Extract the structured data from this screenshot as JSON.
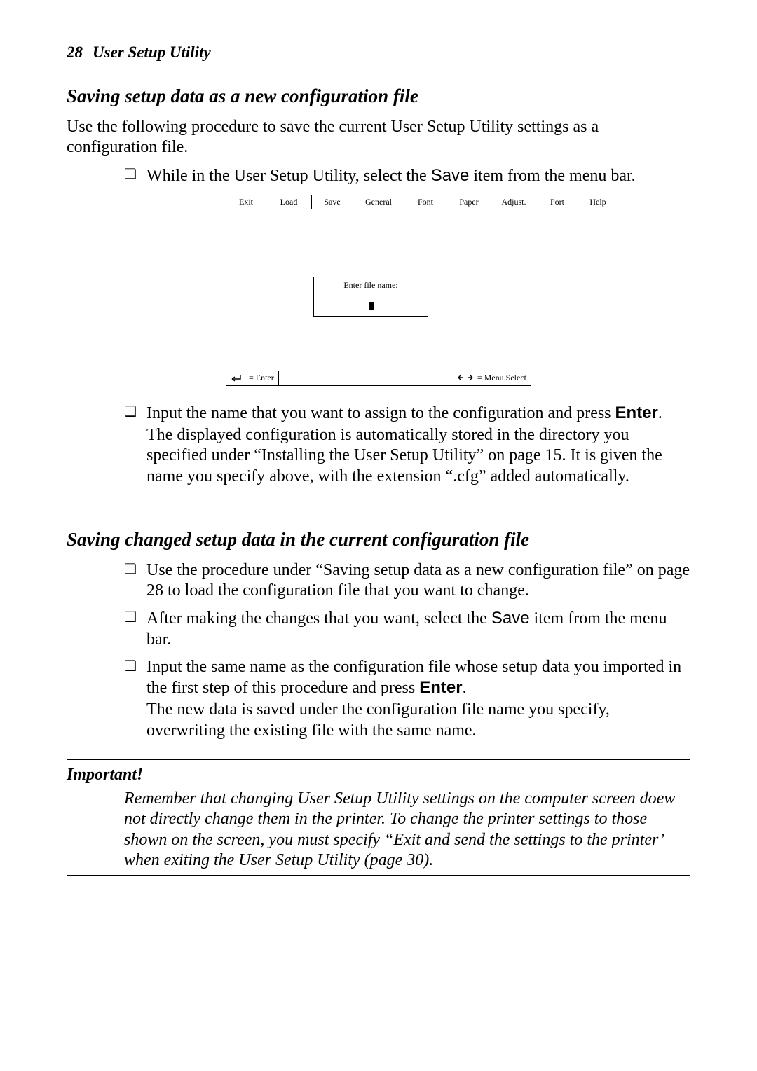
{
  "header": {
    "page_number": "28",
    "running_title": "User Setup Utility"
  },
  "section1": {
    "heading": "Saving setup data as a new configuration file",
    "intro": "Use the following procedure to save the current User Setup Utility settings as a configuration file.",
    "bullet1_pre": "While in the User Setup Utility, select the ",
    "bullet1_save": "Save",
    "bullet1_post": " item from the menu bar.",
    "bullet2_pre": "Input the name that you want to assign to the configuration and press ",
    "bullet2_enter": "Enter",
    "bullet2_post": ".",
    "bullet2_follow": "The displayed configuration is automatically stored in the directory you specified under “Installing the User Setup Utility” on page 15. It is given the name you specify above, with the extension “.cfg” added automatically."
  },
  "figure": {
    "menu": {
      "exit": "Exit",
      "load": "Load",
      "save": "Save",
      "general": "General",
      "font": "Font",
      "paper": "Paper",
      "adjust": "Adjust.",
      "port": "Port",
      "help": "Help"
    },
    "dialog_label": "Enter file name:",
    "status_left": "= Enter",
    "status_right": "= Menu Select"
  },
  "section2": {
    "heading": "Saving changed setup data in the current configuration file",
    "bullet1": "Use the procedure under “Saving setup data as a new configuration file” on page 28 to load the configuration file that you want to change.",
    "bullet2_pre": "After making the changes that you want, select the ",
    "bullet2_save": "Save",
    "bullet2_post": " item from the menu bar.",
    "bullet3_pre": "Input the same name as the configuration file whose setup data you imported in the first step of this procedure and press ",
    "bullet3_enter": "Enter",
    "bullet3_post": ".",
    "bullet3_follow": "The new data is saved under the configuration file name you specify, overwriting the existing file with the same name."
  },
  "important": {
    "label": "Important!",
    "body": "Remember that changing User Setup Utility settings on the computer screen doew not directly change them in the printer. To change the printer settings to those shown on the screen, you must specify “Exit and send the settings to the printer’ when exiting the User Setup Utility (page 30)."
  }
}
